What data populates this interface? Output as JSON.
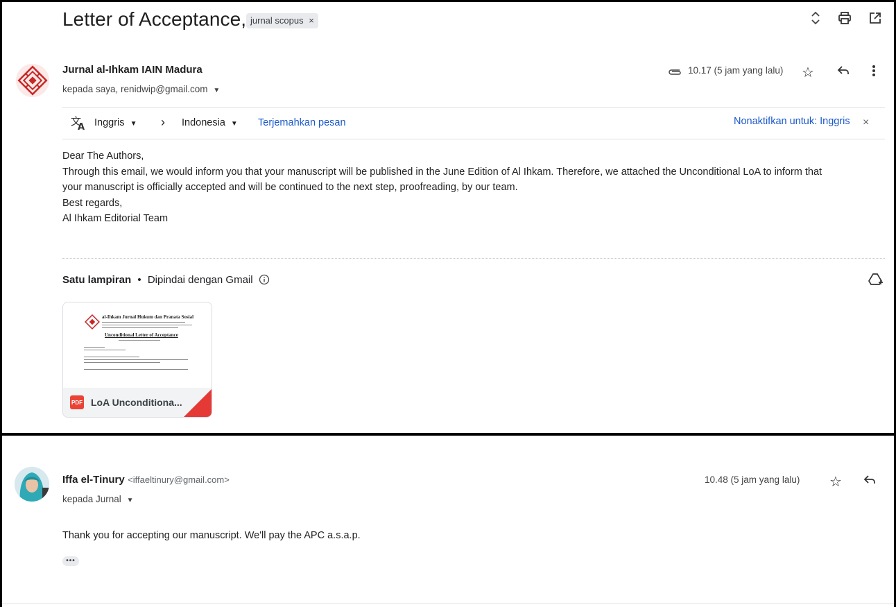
{
  "thread": {
    "subject": "Letter of Acceptance,",
    "label": "jurnal scopus",
    "label_close": "×"
  },
  "icons": {
    "expand": "unfold-icon",
    "print": "print-icon",
    "open_new": "open-in-new-window-icon"
  },
  "message1": {
    "sender_name": "Jurnal al-Ihkam IAIN Madura",
    "recipients": "kepada saya, renidwip@gmail.com",
    "time": "10.17 (5 jam yang lalu)",
    "translate": {
      "from_lang": "Inggris",
      "to_lang": "Indonesia",
      "translate_link": "Terjemahkan pesan",
      "disable_link": "Nonaktifkan untuk: Inggris",
      "close": "×"
    },
    "body": [
      "Dear The Authors,",
      "Through this email, we would inform you that your manuscript will be published in the June Edition of Al Ihkam. Therefore, we attached the Unconditional LoA to inform that",
      "your manuscript is officially accepted and will be continued to the next step, proofreading, by our team.",
      "Best regards,",
      "Al Ihkam Editorial Team"
    ],
    "attachments_title": "Satu lampiran",
    "attachments_separator": "•",
    "attachments_scanned": "Dipindai dengan Gmail",
    "attachment": {
      "type_badge": "PDF",
      "name": "LoA Unconditiona...",
      "preview_heading": "al-Ihkam Jurnal Hukum dan Pranata Sosial",
      "preview_title": "Unconditional Letter of Acceptance"
    }
  },
  "message2": {
    "sender_name": "Iffa el-Tinury",
    "sender_email": "<iffaeltinury@gmail.com>",
    "recipients": "kepada Jurnal",
    "time": "10.48 (5 jam yang lalu)",
    "body": "Thank you for accepting our manuscript. We'll pay the APC a.s.a.p.",
    "ellipsis": "•••"
  },
  "colors": {
    "link": "#1a57c9",
    "pdf_red": "#ea4335",
    "logo_red": "#c62828",
    "frame": "#000000"
  }
}
